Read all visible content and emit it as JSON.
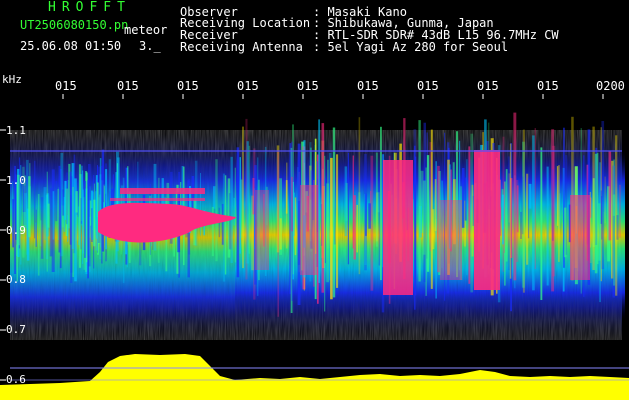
{
  "header": {
    "brand": "HROFFT",
    "filename": "UT2506080150.pn",
    "tag": "meteor",
    "datetime": "25.06.08 01:50",
    "count": "3._"
  },
  "info": [
    {
      "key": "Observer",
      "value": ": Masaki Kano"
    },
    {
      "key": "Receiving Location",
      "value": ": Shibukawa, Gunma, Japan"
    },
    {
      "key": "Receiver",
      "value": ": RTL-SDR SDR# 43dB L15 96.7MHz CW"
    },
    {
      "key": "Receiving Antenna",
      "value": ": 5el Yagi Az 280 for Seoul"
    }
  ],
  "axis": {
    "y_unit": "kHz",
    "y_ticks": [
      "1.1",
      "1.0",
      "0.9",
      "0.8",
      "0.7",
      "0.6"
    ],
    "x_ticks": [
      "015",
      "015",
      "015",
      "015",
      "015",
      "015",
      "015",
      "015",
      "015",
      "0200"
    ]
  },
  "colors": {
    "text_green": "#33ff33",
    "text_white": "#ffffff",
    "signal_peak": "#ff2a80",
    "signal_high": "#ffff00",
    "signal_mid": "#33ff88",
    "signal_low": "#2a4cff",
    "echo_level": "#ffff00"
  }
}
